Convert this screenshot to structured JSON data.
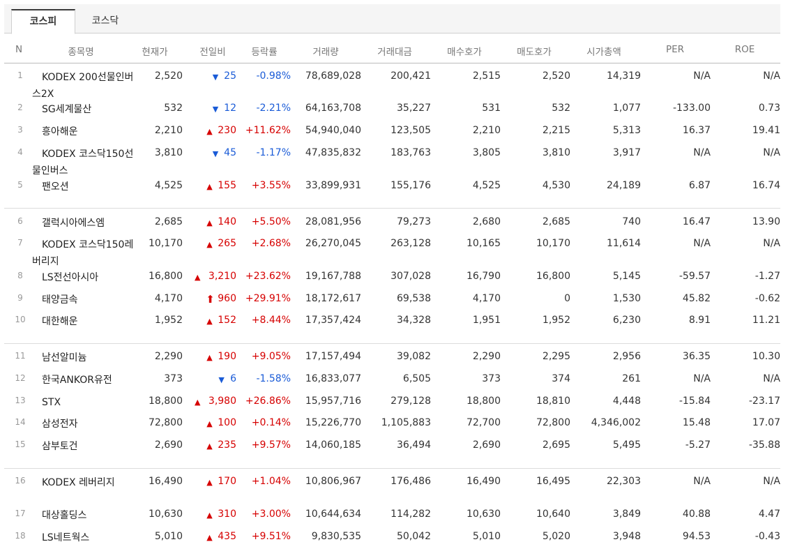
{
  "tabs": [
    {
      "label": "코스피",
      "active": true
    },
    {
      "label": "코스닥",
      "active": false
    }
  ],
  "columns": [
    "N",
    "종목명",
    "현재가",
    "전일비",
    "등락률",
    "거래량",
    "거래대금",
    "매수호가",
    "매도호가",
    "시가총액",
    "PER",
    "ROE"
  ],
  "colors": {
    "up": "#d60000",
    "down": "#1a5bd7"
  },
  "rows": [
    {
      "n": "1",
      "name": "KODEX 200선물인버스2X",
      "price": "2,520",
      "dir": "down",
      "change": "25",
      "rate": "-0.98%",
      "volume": "78,689,028",
      "amount": "200,421",
      "bid": "2,515",
      "ask": "2,520",
      "cap": "14,319",
      "per": "N/A",
      "roe": "N/A"
    },
    {
      "n": "2",
      "name": "SG세계물산",
      "price": "532",
      "dir": "down",
      "change": "12",
      "rate": "-2.21%",
      "volume": "64,163,708",
      "amount": "35,227",
      "bid": "531",
      "ask": "532",
      "cap": "1,077",
      "per": "-133.00",
      "roe": "0.73"
    },
    {
      "n": "3",
      "name": "흥아해운",
      "price": "2,210",
      "dir": "up",
      "change": "230",
      "rate": "+11.62%",
      "volume": "54,940,040",
      "amount": "123,505",
      "bid": "2,210",
      "ask": "2,215",
      "cap": "5,313",
      "per": "16.37",
      "roe": "19.41"
    },
    {
      "n": "4",
      "name": "KODEX 코스닥150선물인버스",
      "price": "3,810",
      "dir": "down",
      "change": "45",
      "rate": "-1.17%",
      "volume": "47,835,832",
      "amount": "183,763",
      "bid": "3,805",
      "ask": "3,810",
      "cap": "3,917",
      "per": "N/A",
      "roe": "N/A"
    },
    {
      "n": "5",
      "name": "팬오션",
      "price": "4,525",
      "dir": "up",
      "change": "155",
      "rate": "+3.55%",
      "volume": "33,899,931",
      "amount": "155,176",
      "bid": "4,525",
      "ask": "4,530",
      "cap": "24,189",
      "per": "6.87",
      "roe": "16.74"
    },
    {
      "n": "6",
      "name": "갤럭시아에스엠",
      "price": "2,685",
      "dir": "up",
      "change": "140",
      "rate": "+5.50%",
      "volume": "28,081,956",
      "amount": "79,273",
      "bid": "2,680",
      "ask": "2,685",
      "cap": "740",
      "per": "16.47",
      "roe": "13.90"
    },
    {
      "n": "7",
      "name": "KODEX 코스닥150레버리지",
      "price": "10,170",
      "dir": "up",
      "change": "265",
      "rate": "+2.68%",
      "volume": "26,270,045",
      "amount": "263,128",
      "bid": "10,165",
      "ask": "10,170",
      "cap": "11,614",
      "per": "N/A",
      "roe": "N/A"
    },
    {
      "n": "8",
      "name": "LS전선아시아",
      "price": "16,800",
      "dir": "up",
      "change": "3,210",
      "rate": "+23.62%",
      "volume": "19,167,788",
      "amount": "307,028",
      "bid": "16,790",
      "ask": "16,800",
      "cap": "5,145",
      "per": "-59.57",
      "roe": "-1.27"
    },
    {
      "n": "9",
      "name": "태양금속",
      "price": "4,170",
      "dir": "upper",
      "change": "960",
      "rate": "+29.91%",
      "volume": "18,172,617",
      "amount": "69,538",
      "bid": "4,170",
      "ask": "0",
      "cap": "1,530",
      "per": "45.82",
      "roe": "-0.62"
    },
    {
      "n": "10",
      "name": "대한해운",
      "price": "1,952",
      "dir": "up",
      "change": "152",
      "rate": "+8.44%",
      "volume": "17,357,424",
      "amount": "34,328",
      "bid": "1,951",
      "ask": "1,952",
      "cap": "6,230",
      "per": "8.91",
      "roe": "11.21"
    },
    {
      "n": "11",
      "name": "남선알미늄",
      "price": "2,290",
      "dir": "up",
      "change": "190",
      "rate": "+9.05%",
      "volume": "17,157,494",
      "amount": "39,082",
      "bid": "2,290",
      "ask": "2,295",
      "cap": "2,956",
      "per": "36.35",
      "roe": "10.30"
    },
    {
      "n": "12",
      "name": "한국ANKOR유전",
      "price": "373",
      "dir": "down",
      "change": "6",
      "rate": "-1.58%",
      "volume": "16,833,077",
      "amount": "6,505",
      "bid": "373",
      "ask": "374",
      "cap": "261",
      "per": "N/A",
      "roe": "N/A"
    },
    {
      "n": "13",
      "name": "STX",
      "price": "18,800",
      "dir": "up",
      "change": "3,980",
      "rate": "+26.86%",
      "volume": "15,957,716",
      "amount": "279,128",
      "bid": "18,800",
      "ask": "18,810",
      "cap": "4,448",
      "per": "-15.84",
      "roe": "-23.17"
    },
    {
      "n": "14",
      "name": "삼성전자",
      "price": "72,800",
      "dir": "up",
      "change": "100",
      "rate": "+0.14%",
      "volume": "15,226,770",
      "amount": "1,105,883",
      "bid": "72,700",
      "ask": "72,800",
      "cap": "4,346,002",
      "per": "15.48",
      "roe": "17.07"
    },
    {
      "n": "15",
      "name": "삼부토건",
      "price": "2,690",
      "dir": "up",
      "change": "235",
      "rate": "+9.57%",
      "volume": "14,060,185",
      "amount": "36,494",
      "bid": "2,690",
      "ask": "2,695",
      "cap": "5,495",
      "per": "-5.27",
      "roe": "-35.88"
    },
    {
      "n": "16",
      "name": "KODEX 레버리지",
      "price": "16,490",
      "dir": "up",
      "change": "170",
      "rate": "+1.04%",
      "volume": "10,806,967",
      "amount": "176,486",
      "bid": "16,490",
      "ask": "16,495",
      "cap": "22,303",
      "per": "N/A",
      "roe": "N/A"
    },
    {
      "n": "17",
      "name": "대상홀딩스",
      "price": "10,630",
      "dir": "up",
      "change": "310",
      "rate": "+3.00%",
      "volume": "10,644,634",
      "amount": "114,282",
      "bid": "10,630",
      "ask": "10,640",
      "cap": "3,849",
      "per": "40.88",
      "roe": "4.47"
    },
    {
      "n": "18",
      "name": "LS네트웍스",
      "price": "5,010",
      "dir": "up",
      "change": "435",
      "rate": "+9.51%",
      "volume": "9,830,535",
      "amount": "50,042",
      "bid": "5,010",
      "ask": "5,020",
      "cap": "3,948",
      "per": "94.53",
      "roe": "-0.43"
    }
  ]
}
